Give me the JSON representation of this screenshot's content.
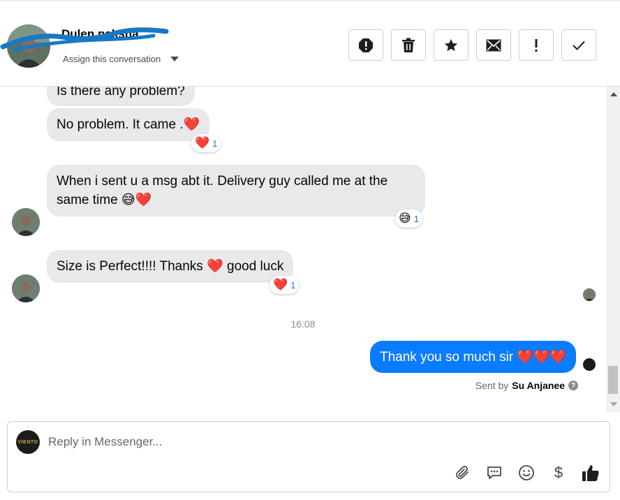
{
  "header": {
    "contact_name": "Dulen   paksha",
    "assign_label": "Assign this conversation",
    "toolbar": [
      {
        "name": "alert-icon",
        "label": "Mark as spam"
      },
      {
        "name": "trash-icon",
        "label": "Delete"
      },
      {
        "name": "star-icon",
        "label": "Star"
      },
      {
        "name": "mail-icon",
        "label": "Mark as unread"
      },
      {
        "name": "exclamation-icon",
        "label": "Follow up"
      },
      {
        "name": "check-icon",
        "label": "Mark as done"
      }
    ]
  },
  "messages": [
    {
      "text": "Is there any problem?",
      "from": "them"
    },
    {
      "text": "No problem.  It came .❤️",
      "from": "them",
      "reaction": "❤️",
      "reaction_count": "1"
    },
    {
      "line1": "When i sent u a msg abt it. Delivery guy called me at the",
      "line2": "same time 😅❤️",
      "from": "them",
      "reaction": "😅",
      "reaction_count": "1"
    },
    {
      "text": "Size is Perfect!!!! Thanks ❤️ good luck",
      "from": "them",
      "reaction": "❤️",
      "reaction_count": "1"
    },
    {
      "text": "Thank you so much sir ❤️❤️❤️",
      "from": "me"
    }
  ],
  "timestamp": "16:08",
  "sent_by": {
    "prefix": "Sent by",
    "name": "Su Anjanee",
    "help": "?"
  },
  "page_avatar_text": "VIENTO",
  "composer": {
    "placeholder": "Reply in Messenger...",
    "value": ""
  },
  "colors": {
    "my_bubble": "#0a7cff",
    "their_bubble": "#e9e9eb",
    "reaction_count": "#1877f2",
    "scribble": "#1878c8"
  }
}
